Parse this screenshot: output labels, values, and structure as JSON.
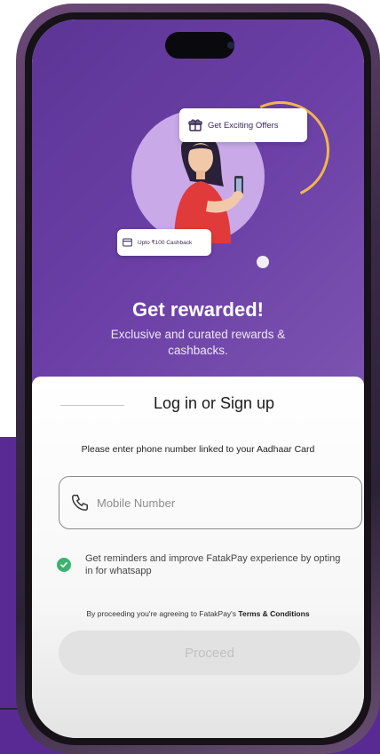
{
  "hero": {
    "chip_offers": "Get Exciting Offers",
    "chip_cashback": "Upto ₹100 Cashback",
    "title": "Get rewarded!",
    "subtitle": "Exclusive and curated rewards & cashbacks."
  },
  "login": {
    "title": "Log in or Sign up",
    "instruction": "Please enter phone number linked to your Aadhaar Card",
    "mobile_placeholder": "Mobile Number",
    "whatsapp_optin": "Get reminders and improve FatakPay experience by opting in for whatsapp",
    "terms_prefix": "By proceeding you're agreeing to FatakPay's ",
    "terms_link": "Terms & Conditions",
    "proceed_label": "Proceed"
  },
  "colors": {
    "hero_purple": "#6b3fa6",
    "accent_yellow": "#f2b64a",
    "check_green": "#3cb371",
    "background_block": "#5a2a94"
  },
  "icons": {
    "gift": "gift-icon",
    "cashback": "card-icon",
    "phone": "phone-icon",
    "check": "check-icon"
  }
}
